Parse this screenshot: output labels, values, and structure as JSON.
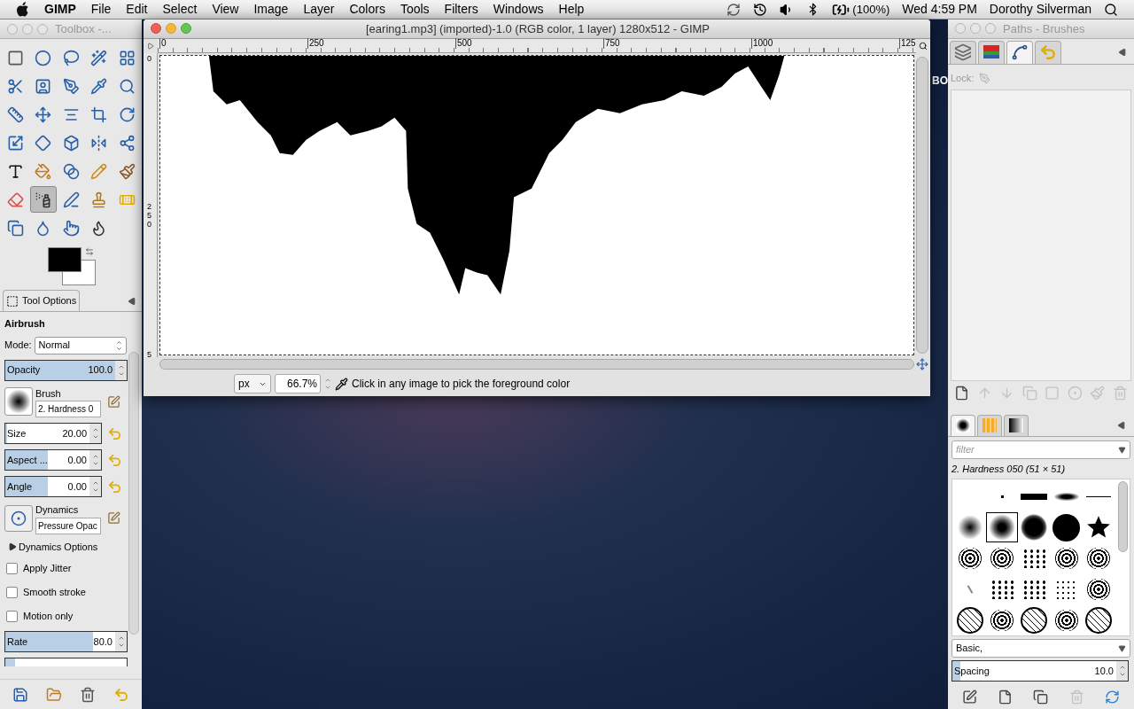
{
  "menubar": {
    "app": "GIMP",
    "menus": [
      "File",
      "Edit",
      "Select",
      "View",
      "Image",
      "Layer",
      "Colors",
      "Tools",
      "Filters",
      "Windows",
      "Help"
    ],
    "battery": "(100%)",
    "clock": "Wed 4:59 PM",
    "user": "Dorothy Silverman"
  },
  "desktop": {
    "label": "BO"
  },
  "toolbox": {
    "title": "Toolbox -...",
    "tools": [
      {
        "kind": "rect-select",
        "selected": false
      },
      {
        "kind": "ellipse-select",
        "selected": false
      },
      {
        "kind": "lasso",
        "selected": false
      },
      {
        "kind": "wand",
        "selected": false
      },
      {
        "kind": "color-select",
        "selected": false
      },
      {
        "kind": "scissors",
        "selected": false
      },
      {
        "kind": "foreground-select",
        "selected": false
      },
      {
        "kind": "paths",
        "selected": false
      },
      {
        "kind": "color-picker",
        "selected": false
      },
      {
        "kind": "zoom",
        "selected": false
      },
      {
        "kind": "measure",
        "selected": false
      },
      {
        "kind": "move",
        "selected": false
      },
      {
        "kind": "align",
        "selected": false
      },
      {
        "kind": "crop",
        "selected": false
      },
      {
        "kind": "rotate",
        "selected": false
      },
      {
        "kind": "scale",
        "selected": false
      },
      {
        "kind": "shear",
        "selected": false
      },
      {
        "kind": "perspective",
        "selected": false
      },
      {
        "kind": "flip",
        "selected": false
      },
      {
        "kind": "cage",
        "selected": false
      },
      {
        "kind": "text",
        "selected": false
      },
      {
        "kind": "bucket",
        "selected": false
      },
      {
        "kind": "blend",
        "selected": false
      },
      {
        "kind": "pencil",
        "selected": false
      },
      {
        "kind": "paintbrush",
        "selected": false
      },
      {
        "kind": "eraser",
        "selected": false
      },
      {
        "kind": "airbrush",
        "selected": true
      },
      {
        "kind": "ink",
        "selected": false
      },
      {
        "kind": "clone",
        "selected": false
      },
      {
        "kind": "heal",
        "selected": false
      },
      {
        "kind": "perspective-clone",
        "selected": false
      },
      {
        "kind": "blur",
        "selected": false
      },
      {
        "kind": "smudge",
        "selected": false
      },
      {
        "kind": "dodge",
        "selected": false
      }
    ],
    "options": {
      "tab": "Tool Options",
      "tool": "Airbrush",
      "mode_label": "Mode:",
      "mode": "Normal",
      "opacity": {
        "label": "Opacity",
        "value": "100.0",
        "level": 1
      },
      "brush": {
        "label": "Brush",
        "value": "2. Hardness 0"
      },
      "sliders": [
        {
          "label": "Size",
          "value": "20.00",
          "level": 0.02
        },
        {
          "label": "Aspect ...",
          "value": "0.00",
          "level": 0.5
        },
        {
          "label": "Angle",
          "value": "0.00",
          "level": 0.5
        }
      ],
      "dynamics": {
        "label": "Dynamics",
        "value": "Pressure Opac"
      },
      "dynamics_options": {
        "label": "Dynamics Options",
        "expanded": false
      },
      "checkboxes": [
        {
          "label": "Apply Jitter",
          "checked": false
        },
        {
          "label": "Smooth stroke",
          "checked": false
        },
        {
          "label": "Motion only",
          "checked": false
        }
      ],
      "rate": {
        "label": "Rate",
        "value": "80.0",
        "level": 0.8
      },
      "last_slider": {
        "level": 0.08
      }
    }
  },
  "image_window": {
    "title": "[earing1.mp3] (imported)-1.0 (RGB color, 1 layer) 1280x512 - GIMP",
    "hruler": [
      "0",
      "250",
      "500",
      "750",
      "1000",
      "125"
    ],
    "vruler": [
      "0",
      "250",
      "5"
    ],
    "unit": "px",
    "zoom": "66.7%",
    "status": "Click in any image to pick the foreground color"
  },
  "dock": {
    "title": "Paths - Brushes",
    "tabs": [
      {
        "kind": "layers",
        "selected": false
      },
      {
        "kind": "channels",
        "selected": false
      },
      {
        "kind": "paths",
        "selected": true
      },
      {
        "kind": "undo",
        "selected": false
      }
    ],
    "lock_label": "Lock:",
    "path_buttons": [
      {
        "kind": "new",
        "disabled": false
      },
      {
        "kind": "raise",
        "disabled": true
      },
      {
        "kind": "lower",
        "disabled": true
      },
      {
        "kind": "duplicate",
        "disabled": true
      },
      {
        "kind": "to-selection",
        "disabled": true
      },
      {
        "kind": "from-selection",
        "disabled": true
      },
      {
        "kind": "stroke",
        "disabled": true
      },
      {
        "kind": "delete",
        "disabled": true
      }
    ],
    "brush_tabs": [
      {
        "kind": "brushes",
        "selected": true
      },
      {
        "kind": "patterns",
        "selected": false
      },
      {
        "kind": "gradients",
        "selected": false
      }
    ],
    "filter": {
      "placeholder": "filter"
    },
    "brush_name": "2. Hardness 050 (51 × 51)",
    "brushes": [
      {
        "kind": "pixel",
        "selected": false
      },
      {
        "kind": "block",
        "selected": false
      },
      {
        "kind": "ellipse",
        "selected": false
      },
      {
        "kind": "line",
        "selected": false
      },
      {
        "kind": "soft",
        "selected": false
      },
      {
        "kind": "medium",
        "selected": true
      },
      {
        "kind": "firm",
        "selected": false
      },
      {
        "kind": "hard",
        "selected": false
      },
      {
        "kind": "star",
        "selected": false
      },
      {
        "kind": "texture",
        "selected": false
      },
      {
        "kind": "texture",
        "selected": false
      },
      {
        "kind": "scatter",
        "selected": false
      },
      {
        "kind": "texture",
        "selected": false
      },
      {
        "kind": "texture",
        "selected": false
      },
      {
        "kind": "streak",
        "selected": false
      },
      {
        "kind": "scatter",
        "selected": false
      },
      {
        "kind": "scatter",
        "selected": false
      },
      {
        "kind": "dots",
        "selected": false
      },
      {
        "kind": "texture",
        "selected": false
      },
      {
        "kind": "cells",
        "selected": false
      },
      {
        "kind": "texture",
        "selected": false
      },
      {
        "kind": "cells",
        "selected": false
      },
      {
        "kind": "texture",
        "selected": false
      },
      {
        "kind": "cells",
        "selected": false
      }
    ],
    "tag": "Basic,",
    "spacing": {
      "label": "Spacing",
      "value": "10.0",
      "level": 0.05
    },
    "brush_buttons": [
      {
        "kind": "edit",
        "disabled": false
      },
      {
        "kind": "new",
        "disabled": false
      },
      {
        "kind": "duplicate",
        "disabled": false
      },
      {
        "kind": "delete",
        "disabled": true
      },
      {
        "kind": "refresh",
        "disabled": false
      }
    ]
  }
}
